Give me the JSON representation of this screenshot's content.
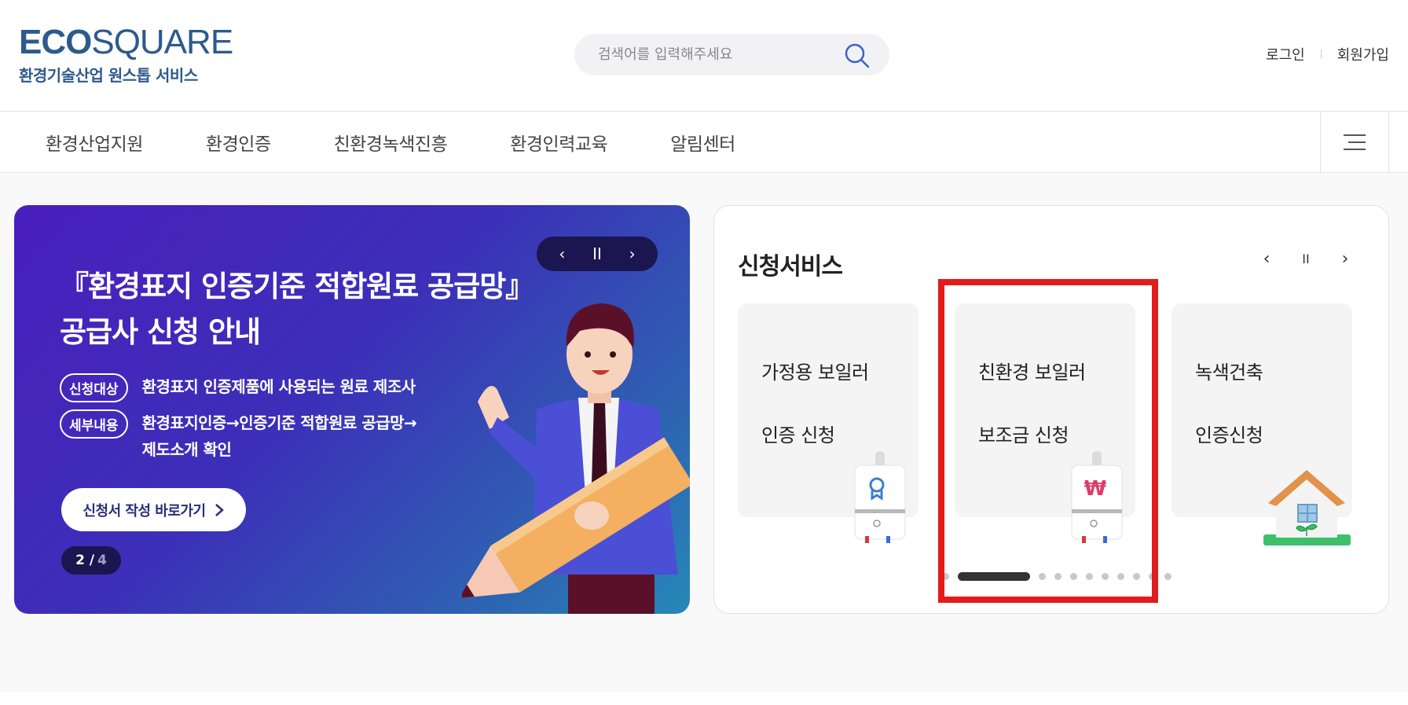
{
  "logo": {
    "eco": "ECO",
    "square": "SQUARE",
    "subtitle": "환경기술산업 원스톱 서비스"
  },
  "search": {
    "placeholder": "검색어를 입력해주세요"
  },
  "user_links": {
    "login": "로그인",
    "signup": "회원가입"
  },
  "gnb": {
    "items": [
      "환경산업지원",
      "환경인증",
      "친환경녹색진흥",
      "환경인력교육",
      "알림센터"
    ]
  },
  "banner": {
    "title_line1": "『환경표지 인증기준 적합원료 공급망』",
    "title_line2": "공급사 신청 안내",
    "tag1": "신청대상",
    "text1": "환경표지 인증제품에 사용되는 원료 제조사",
    "tag2": "세부내용",
    "text2_line1": "환경표지인증→인증기준 적합원료 공급망→",
    "text2_line2": "제도소개 확인",
    "button": "신청서 작성 바로가기",
    "count_current": "2 /",
    "count_total": "4",
    "ctrl_prev": "‹",
    "ctrl_pause": "II",
    "ctrl_next": "›"
  },
  "services": {
    "title": "신청서비스",
    "ctrl_prev": "‹",
    "ctrl_pause": "II",
    "ctrl_next": "›",
    "cards": [
      {
        "line1": "가정용 보일러",
        "line2": "인증 신청",
        "icon": "boiler-certificate-icon"
      },
      {
        "line1": "친환경 보일러",
        "line2": "보조금 신청",
        "icon": "boiler-won-icon"
      },
      {
        "line1": "녹색건축",
        "line2": "인증신청",
        "icon": "green-house-icon"
      }
    ],
    "pager": {
      "active_index": 1,
      "total": 11
    }
  },
  "colors": {
    "brand": "#2d5a8c",
    "banner_start": "#4a1fbd",
    "banner_end": "#2788b8",
    "highlight": "#e21c1c"
  }
}
